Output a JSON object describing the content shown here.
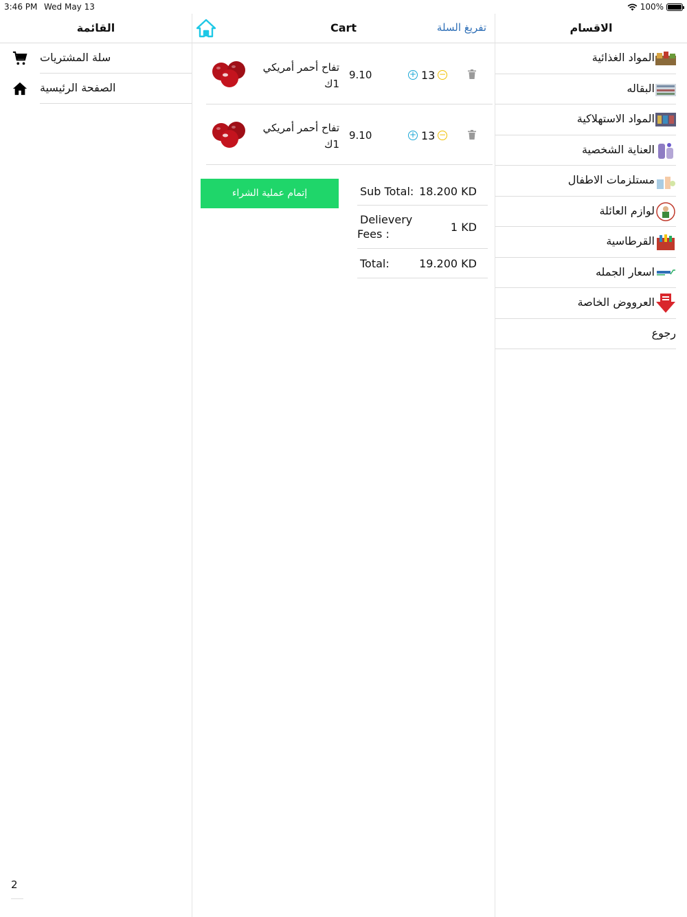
{
  "status_bar": {
    "time": "3:46 PM",
    "date": "Wed May 13",
    "battery": "100%",
    "battery_level": 1.0
  },
  "left_pane": {
    "title": "القائمة",
    "items": [
      {
        "label": "سلة المشتريات",
        "icon": "cart-icon"
      },
      {
        "label": "الصفحة الرئيسية",
        "icon": "home-icon"
      }
    ],
    "page_number": "2"
  },
  "cart": {
    "title": "Cart",
    "clear_label": "تفريغ السلة",
    "home_icon": "home-icon",
    "items": [
      {
        "name": "تفاح أحمر أمريكي 1ك",
        "price": "9.10",
        "quantity": "13",
        "image": "red-apples"
      },
      {
        "name": "تفاح أحمر أمريكي 1ك",
        "price": "9.10",
        "quantity": "13",
        "image": "red-apples"
      }
    ],
    "checkout_label": "إتمام عملية الشراء",
    "checkout_color": "#1fd66a",
    "summary": {
      "subtotal_label": "Sub Total:",
      "subtotal_value": "18.200 KD",
      "delivery_label_1": "Delievery",
      "delivery_label_2": "Fees :",
      "delivery_value": "1 KD",
      "total_label": "Total:",
      "total_value": "19.200 KD"
    }
  },
  "right_pane": {
    "title": "الاقسام",
    "categories": [
      {
        "label": "المواد الغذائية"
      },
      {
        "label": "البقاله"
      },
      {
        "label": "المواد الاستهلاكية"
      },
      {
        "label": "العناية الشخصية"
      },
      {
        "label": "مستلزمات الاطفال"
      },
      {
        "label": "لوازم العائلة"
      },
      {
        "label": "القرطاسية"
      },
      {
        "label": "اسعار الجمله"
      },
      {
        "label": "العرووض الخاصة"
      }
    ],
    "back_label": "رجوع"
  },
  "colors": {
    "accent": "#2e6fb7",
    "home_icon": "#1ec8e6",
    "plus": "#1aa7d6",
    "minus": "#f0c000"
  }
}
